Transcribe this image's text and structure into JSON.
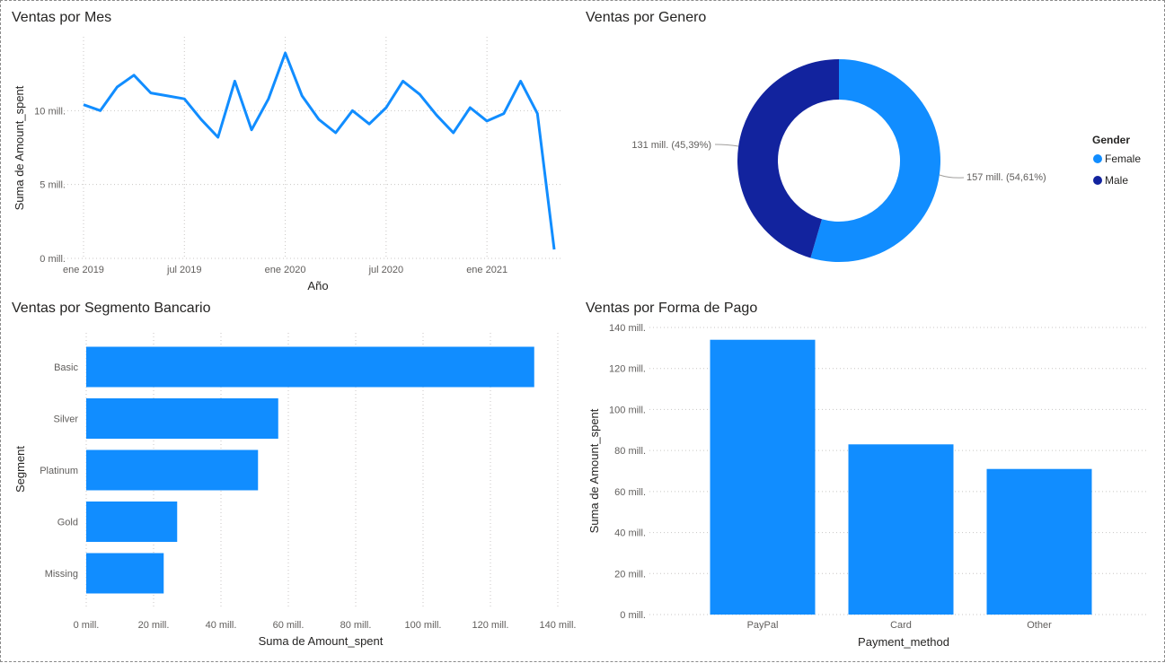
{
  "colors": {
    "primary": "#118DFF",
    "secondary": "#12239E"
  },
  "chart_data": [
    {
      "type": "line",
      "title": "Ventas por Mes",
      "xlabel": "Año",
      "ylabel": "Suma de Amount_spent",
      "x_ticks": [
        "ene 2019",
        "jul 2019",
        "ene 2020",
        "jul 2020",
        "ene 2021"
      ],
      "y_ticks": [
        "0 mill.",
        "5 mill.",
        "10 mill."
      ],
      "ylim": [
        0,
        15
      ],
      "x": [
        "2019-01",
        "2019-02",
        "2019-03",
        "2019-04",
        "2019-05",
        "2019-06",
        "2019-07",
        "2019-08",
        "2019-09",
        "2019-10",
        "2019-11",
        "2019-12",
        "2020-01",
        "2020-02",
        "2020-03",
        "2020-04",
        "2020-05",
        "2020-06",
        "2020-07",
        "2020-08",
        "2020-09",
        "2020-10",
        "2020-11",
        "2020-12",
        "2021-01",
        "2021-02",
        "2021-03",
        "2021-04",
        "2021-05"
      ],
      "series": [
        {
          "values": [
            10.4,
            10.0,
            11.6,
            12.4,
            11.2,
            11.0,
            10.8,
            9.4,
            8.2,
            12.0,
            8.7,
            10.8,
            13.9,
            11.0,
            9.4,
            8.5,
            10.0,
            9.1,
            10.2,
            12.0,
            11.1,
            9.7,
            8.5,
            10.2,
            9.3,
            9.8,
            12.0,
            9.8,
            0.6
          ]
        }
      ]
    },
    {
      "type": "pie",
      "title": "Ventas por Genero",
      "legend_title": "Gender",
      "categories": [
        "Female",
        "Male"
      ],
      "values": [
        157,
        131
      ],
      "data_labels": [
        "157 mill. (54,61%)",
        "131 mill. (45,39%)"
      ],
      "legend": "right"
    },
    {
      "type": "bar",
      "orientation": "horizontal",
      "title": "Ventas por Segmento Bancario",
      "xlabel": "Suma de Amount_spent",
      "ylabel": "Segment",
      "categories": [
        "Basic",
        "Silver",
        "Platinum",
        "Gold",
        "Missing"
      ],
      "values": [
        133,
        57,
        51,
        27,
        23
      ],
      "x_ticks": [
        "0 mill.",
        "20 mill.",
        "40 mill.",
        "60 mill.",
        "80 mill.",
        "100 mill.",
        "120 mill.",
        "140 mill."
      ],
      "xlim": [
        0,
        140
      ]
    },
    {
      "type": "bar",
      "title": "Ventas por Forma de Pago",
      "xlabel": "Payment_method",
      "ylabel": "Suma de Amount_spent",
      "categories": [
        "PayPal",
        "Card",
        "Other"
      ],
      "values": [
        134,
        83,
        71
      ],
      "y_ticks": [
        "0 mill.",
        "20 mill.",
        "40 mill.",
        "60 mill.",
        "80 mill.",
        "100 mill.",
        "120 mill.",
        "140 mill."
      ],
      "ylim": [
        0,
        140
      ]
    }
  ]
}
